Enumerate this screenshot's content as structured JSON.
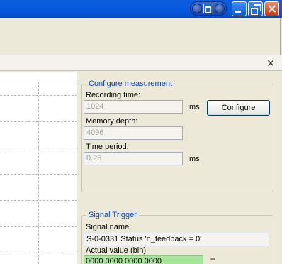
{
  "window": {
    "buttons": [
      "restore-pill",
      "minimize",
      "maximize",
      "close"
    ]
  },
  "panel": {
    "close_glyph": "✕"
  },
  "configure_measurement": {
    "title": "Configure measurement",
    "recording_time_label": "Recording time:",
    "recording_time_value": "1024",
    "recording_time_unit": "ms",
    "configure_button": "Configure",
    "memory_depth_label": "Memory depth:",
    "memory_depth_value": "4096",
    "time_period_label": "Time period:",
    "time_period_value": "0.25",
    "time_period_unit": "ms"
  },
  "signal_trigger": {
    "title": "Signal Trigger",
    "signal_name_label": "Signal name:",
    "signal_name_value": "S-0-0331 Status 'n_feedback = 0'",
    "actual_value_label": "Actual value (bin):",
    "actual_value": "0000 0000 0000 0000",
    "trailing": "--"
  },
  "colors": {
    "title_bar": "#0b5bdc",
    "group_title": "#0046d5",
    "actual_value_bg": "#a7e59b"
  }
}
